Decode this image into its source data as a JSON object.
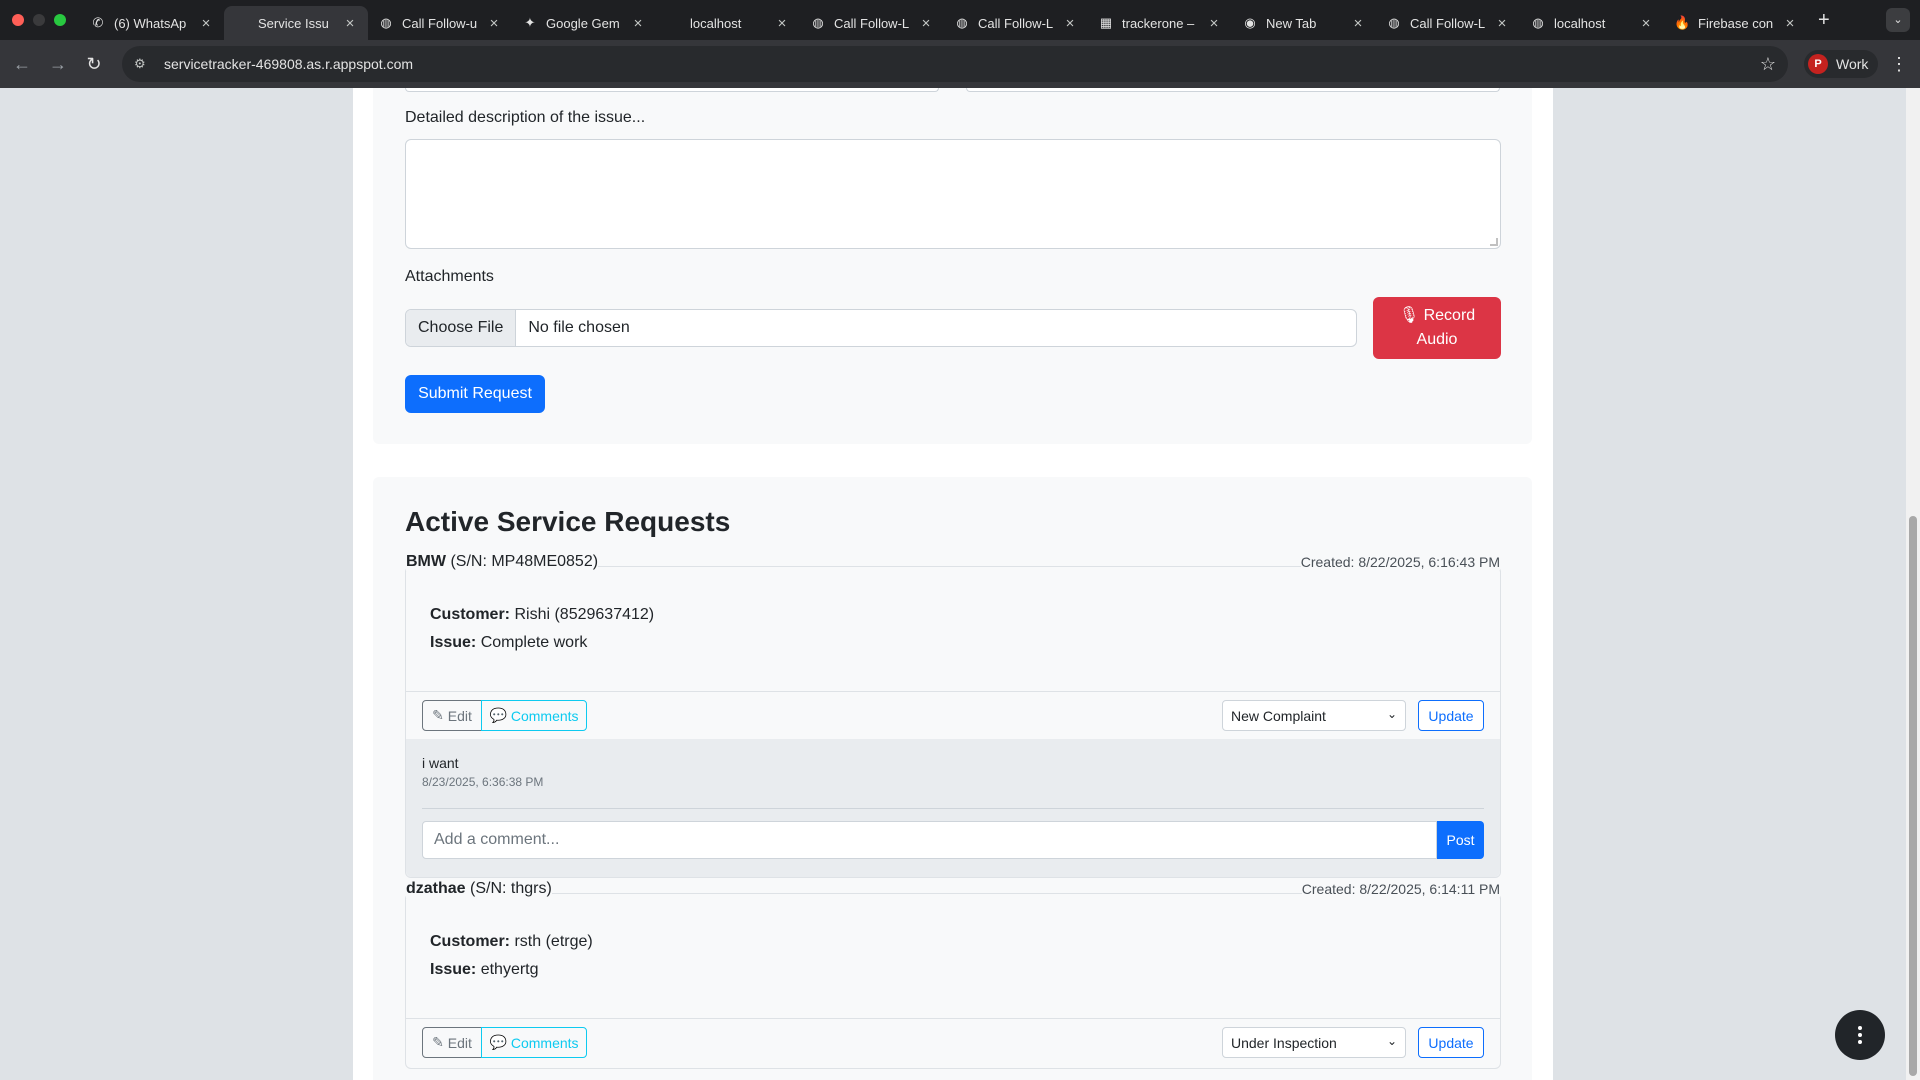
{
  "browser": {
    "tabs": [
      {
        "title": "(6) WhatsAp",
        "icon": "whatsapp-icon",
        "glyph": "✆"
      },
      {
        "title": "Service Issu",
        "icon": "none",
        "glyph": ""
      },
      {
        "title": "Call Follow-u",
        "icon": "globe-icon",
        "glyph": "◍"
      },
      {
        "title": "Google Gem",
        "icon": "gemini-icon",
        "glyph": "✦"
      },
      {
        "title": "localhost",
        "icon": "none",
        "glyph": ""
      },
      {
        "title": "Call Follow-L",
        "icon": "globe-icon",
        "glyph": "◍"
      },
      {
        "title": "Call Follow-L",
        "icon": "globe-icon",
        "glyph": "◍"
      },
      {
        "title": "trackerone –",
        "icon": "table-icon",
        "glyph": "▦"
      },
      {
        "title": "New Tab",
        "icon": "chrome-icon",
        "glyph": "◉"
      },
      {
        "title": "Call Follow-L",
        "icon": "globe-icon",
        "glyph": "◍"
      },
      {
        "title": "localhost",
        "icon": "globe-icon",
        "glyph": "◍"
      },
      {
        "title": "Firebase con",
        "icon": "firebase-icon",
        "glyph": "🔥"
      }
    ],
    "url": "servicetracker-469808.as.r.appspot.com",
    "profile_initial": "P",
    "profile_label": "Work"
  },
  "form": {
    "description_label": "Detailed description of the issue...",
    "attachments_label": "Attachments",
    "choose_file": "Choose File",
    "no_file": "No file chosen",
    "record_line1": "Record",
    "record_line2": "Audio",
    "submit": "Submit Request"
  },
  "requests_section": {
    "title": "Active Service Requests",
    "labels": {
      "customer": "Customer:",
      "issue": "Issue:",
      "edit": "Edit",
      "comments": "Comments",
      "update": "Update",
      "post": "Post",
      "comment_placeholder": "Add a comment..."
    },
    "items": [
      {
        "name": "BMW",
        "serial": "(S/N: MP48ME0852)",
        "created": "Created: 8/22/2025, 6:16:43 PM",
        "customer": "Rishi (8529637412)",
        "issue": "Complete work",
        "status": "New Complaint",
        "comments": [
          {
            "text": "i want",
            "time": "8/23/2025, 6:36:38 PM"
          }
        ]
      },
      {
        "name": "dzathae",
        "serial": "(S/N: thgrs)",
        "created": "Created: 8/22/2025, 6:14:11 PM",
        "customer": "rsth (etrge)",
        "issue": "ethyertg",
        "status": "Under Inspection"
      }
    ]
  },
  "colors": {
    "primary": "#0d6efd",
    "danger": "#dc3545",
    "info": "#0dcaf0",
    "secondary": "#6c757d"
  }
}
